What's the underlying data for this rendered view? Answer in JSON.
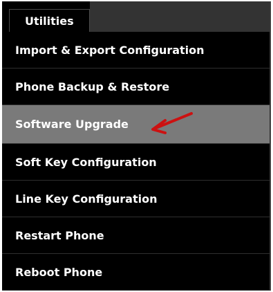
{
  "tab": {
    "label": "Utilities"
  },
  "menu": {
    "items": [
      {
        "label": "Import & Export Configuration"
      },
      {
        "label": "Phone Backup & Restore"
      },
      {
        "label": "Software Upgrade",
        "selected": true
      },
      {
        "label": "Soft Key Configuration"
      },
      {
        "label": "Line Key Configuration"
      },
      {
        "label": "Restart Phone"
      },
      {
        "label": "Reboot Phone"
      }
    ]
  },
  "annotation": {
    "arrow_color": "#cc1111",
    "arrow_icon": "red-arrow-icon"
  },
  "colors": {
    "background": "#000000",
    "selected_row": "#7a7a7a",
    "text": "#ffffff"
  }
}
